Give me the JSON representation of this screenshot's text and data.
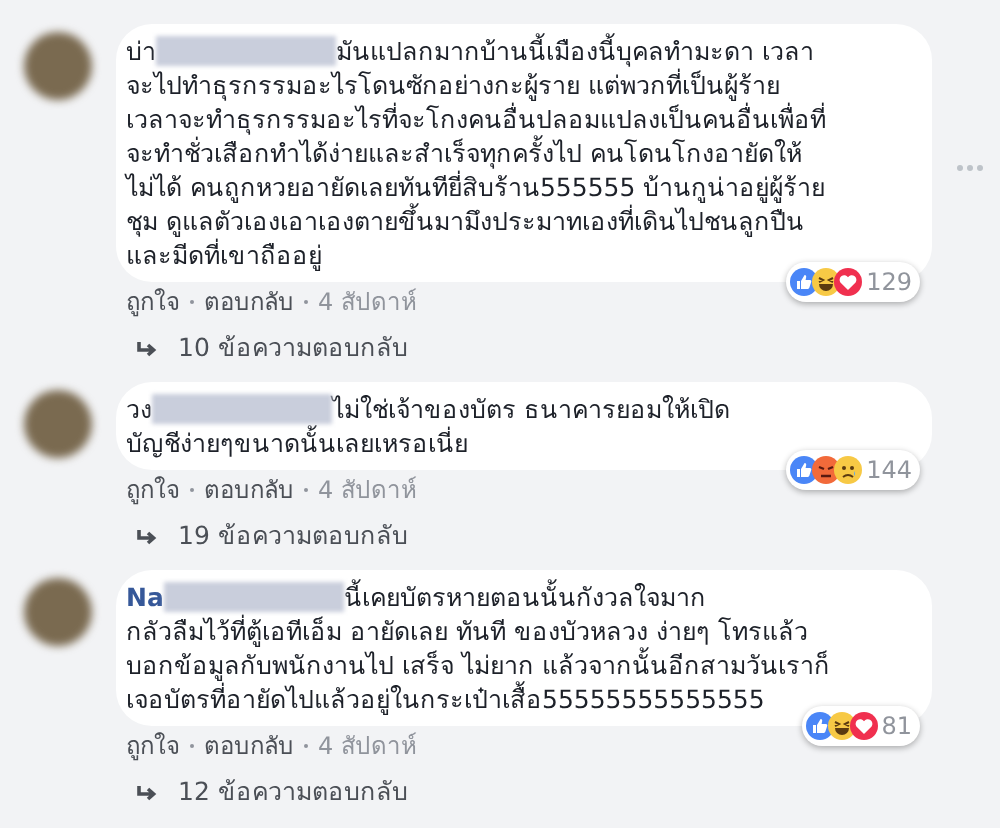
{
  "comments": [
    {
      "author": "บ่า",
      "author_bold": false,
      "lines": [
        "มันแปลกมากบ้านนี้เมืองนี้บุคลทำมะดา เวลา",
        "จะไปทำธุรกรรมอะไรโดนซักอย่างกะผู้ราย แต่พวกที่เป็นผู้ร้าย",
        "เวลาจะทำธุรกรรมอะไรที่จะโกงคนอื่นปลอมแปลงเป็นคนอื่นเพื่อที่",
        "จะทำชั่วเสือกทำได้ง่ายและสำเร็จทุกครั้งไป คนโดนโกงอายัดให้",
        "ไม่ได้ คนถูกหวยอายัดเลยทันทียี่สิบร้าน555555 บ้านกูน่าอยู่ผู้ร้าย",
        "ชุม ดูแลตัวเองเอาเองตายขึ้นมามึงประมาทเองที่เดินไปชนลูกปืน",
        "และมีดที่เขาถืออยู่"
      ],
      "options_shown": true,
      "reactions": [
        {
          "kind": "like"
        },
        {
          "kind": "haha"
        },
        {
          "kind": "love"
        }
      ],
      "reaction_count": "129",
      "actions": [
        "ถูกใจ",
        "ตอบกลับ"
      ],
      "time": "4 สัปดาห์",
      "replies": "10 ข้อความตอบกลับ"
    },
    {
      "author": "วง",
      "author_bold": false,
      "lines": [
        "ไม่ใช่เจ้าของบัตร ธนาคารยอมให้เปิด",
        "บัญชีง่ายๆขนาดนั้นเลยเหรอเนี่ย"
      ],
      "options_shown": false,
      "reactions": [
        {
          "kind": "like"
        },
        {
          "kind": "angry"
        },
        {
          "kind": "sad"
        }
      ],
      "reaction_count": "144",
      "actions": [
        "ถูกใจ",
        "ตอบกลับ"
      ],
      "time": "4 สัปดาห์",
      "replies": "19 ข้อความตอบกลับ"
    },
    {
      "author": "Na",
      "author_bold": true,
      "lines": [
        "นี้เคยบัตรหายตอนนั้นกังวลใจมาก",
        "กลัวลืมไว้ที่ตู้เอทีเอ็ม อายัดเลย ทันที ของบัวหลวง ง่ายๆ โทรแล้ว",
        "บอกข้อมูลกับพนักงานไป เสร็จ ไม่ยาก แล้วจากนั้นอีกสามวันเราก็",
        "เจอบัตรที่อายัดไปแล้วอยู่ในกระเป๋าเสื้อ55555555555555"
      ],
      "options_shown": false,
      "reactions": [
        {
          "kind": "like"
        },
        {
          "kind": "haha"
        },
        {
          "kind": "love"
        }
      ],
      "reaction_count": "81",
      "actions": [
        "ถูกใจ",
        "ตอบกลับ"
      ],
      "time": "4 สัปดาห์",
      "replies": "12 ข้อความตอบกลับ"
    }
  ]
}
